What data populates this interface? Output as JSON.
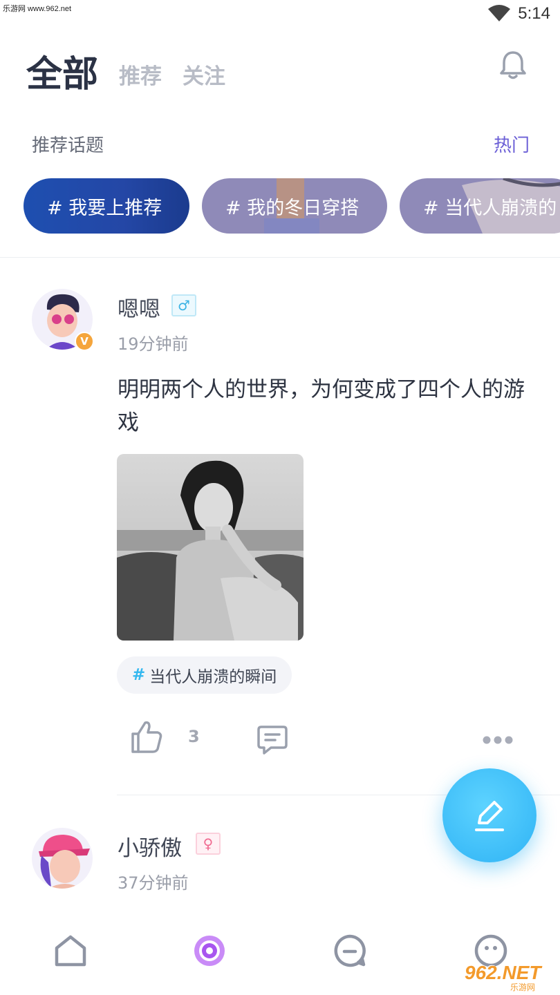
{
  "status_bar": {
    "watermark": "乐游网 www.962.net",
    "time": "5:14"
  },
  "header": {
    "tabs": [
      {
        "label": "全部",
        "active": true
      },
      {
        "label": "推荐",
        "active": false
      },
      {
        "label": "关注",
        "active": false
      }
    ],
    "bell_icon": "bell-icon"
  },
  "topics_section": {
    "title": "推荐话题",
    "more_label": "热门",
    "topics": [
      {
        "label": "# 我要上推荐"
      },
      {
        "label": "# 我的冬日穿搭"
      },
      {
        "label": "# 当代人崩溃的"
      }
    ]
  },
  "posts": [
    {
      "user_name": "嗯嗯",
      "gender_symbol": "♂",
      "verified_badge": "V",
      "time": "19分钟前",
      "text": "明明两个人的世界，为何变成了四个人的游戏",
      "tag_hash": "#",
      "tag_label": "当代人崩溃的瞬间",
      "like_count": "3"
    },
    {
      "user_name": "小骄傲",
      "gender_symbol": "♀",
      "time": "37分钟前"
    }
  ],
  "bottom_nav": {
    "items": [
      "home-icon",
      "discover-icon",
      "message-icon",
      "profile-icon"
    ]
  },
  "watermark_bottom": {
    "logo": "962.NET",
    "sub": "乐游网"
  },
  "colors": {
    "accent_blue": "#3cc3f5",
    "hot_purple": "#6b5fd6",
    "fab_blue": "#2fb3f5"
  }
}
